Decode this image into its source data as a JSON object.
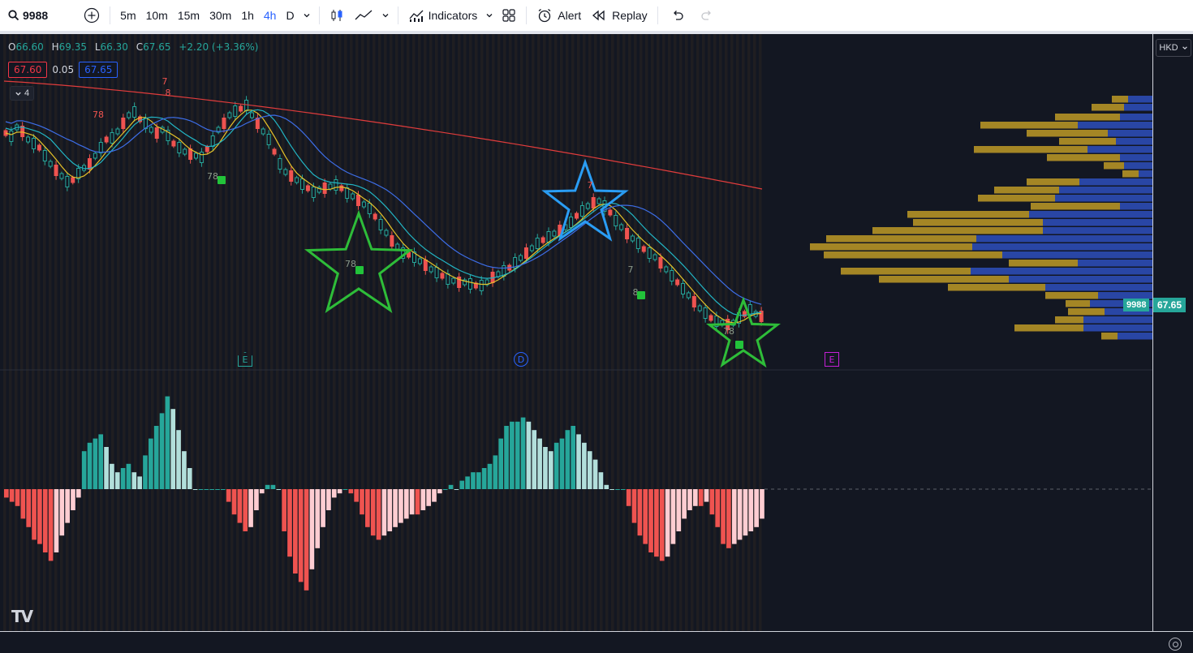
{
  "toolbar": {
    "symbol": "9988",
    "intervals": [
      "5m",
      "10m",
      "15m",
      "30m",
      "1h",
      "4h",
      "D"
    ],
    "active_interval": "4h",
    "indicators_label": "Indicators",
    "alert_label": "Alert",
    "replay_label": "Replay"
  },
  "legend": {
    "open_label": "O",
    "open": "66.60",
    "high_label": "H",
    "high": "69.35",
    "low_label": "L",
    "low": "66.30",
    "close_label": "C",
    "close": "67.65",
    "change": "+2.20 (+3.36%)",
    "bid": "67.60",
    "spread": "0.05",
    "ask": "67.65",
    "indicator_count": "4"
  },
  "price_axis": {
    "currency": "HKD",
    "symbol_tag": "9988",
    "last_price": "67.65"
  },
  "events": {
    "earnings_1": "E",
    "dividend": "D",
    "earnings_2": "E"
  },
  "markers": {
    "td_labels": [
      "78",
      "7",
      "8",
      "78",
      "78",
      "7",
      "7",
      "8",
      "78"
    ]
  },
  "colors": {
    "up": "#26a69a",
    "down": "#ef5350",
    "ma_red": "#e03c3c",
    "ma_blue": "#3d6ee8",
    "ma_cyan": "#22b5c4",
    "ma_yellow": "#e6c229",
    "star_green": "#2ebd39",
    "star_blue": "#2a9df4",
    "vp_gold": "#c9a227",
    "vp_blue": "#2f52c7",
    "hist_up_strong": "#26a69a",
    "hist_up_weak": "#b2dfdb",
    "hist_down_strong": "#ef5350",
    "hist_down_weak": "#ffcdd2"
  },
  "chart_data": {
    "type": "candlestick",
    "symbol": "9988",
    "interval": "4h",
    "ohlc_last": {
      "open": 66.6,
      "high": 69.35,
      "low": 66.3,
      "close": 67.65
    },
    "histogram_note": "",
    "histogram": [
      -2,
      -3,
      -4,
      -7,
      -9,
      -12,
      -13,
      -15,
      -17,
      -15,
      -11,
      -8,
      -5,
      -2,
      9,
      11,
      12,
      13,
      10,
      6,
      4,
      5,
      6,
      4,
      3,
      8,
      12,
      15,
      18,
      22,
      19,
      14,
      9,
      5,
      0,
      0,
      0,
      0,
      0,
      0,
      -3,
      -6,
      -8,
      -10,
      -9,
      -5,
      -1,
      1,
      1,
      0,
      -10,
      -16,
      -20,
      -22,
      -24,
      -19,
      -14,
      -9,
      -5,
      -2,
      -1,
      0,
      -1,
      -3,
      -6,
      -9,
      -11,
      -12,
      -11,
      -10,
      -9,
      -8,
      -7,
      -6,
      -6,
      -5,
      -4,
      -3,
      -1,
      0,
      1,
      0,
      2,
      3,
      4,
      4,
      5,
      6,
      8,
      12,
      15,
      16,
      16,
      17,
      16,
      14,
      12,
      10,
      9,
      11,
      12,
      14,
      15,
      13,
      11,
      9,
      7,
      4,
      1,
      0,
      0,
      0,
      -4,
      -8,
      -11,
      -13,
      -15,
      -16,
      -17,
      -16,
      -13,
      -10,
      -7,
      -5,
      -4,
      -4,
      -3,
      -6,
      -9,
      -13,
      -14,
      -13,
      -12,
      -11,
      -10,
      -9,
      -7
    ]
  }
}
